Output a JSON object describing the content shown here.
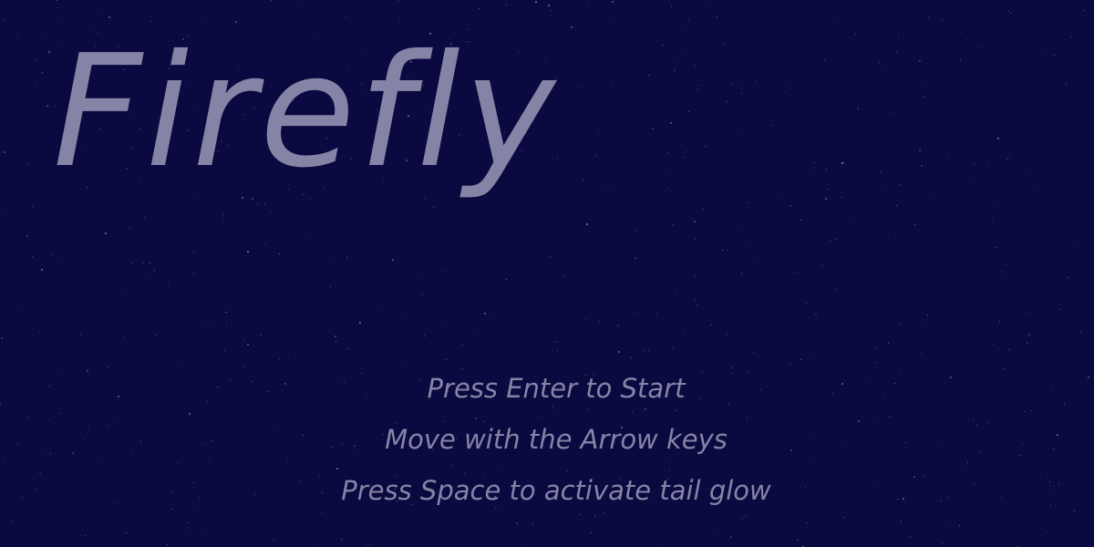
{
  "game": {
    "title": "Firefly",
    "instructions": [
      "Press Enter to Start",
      "Move with the Arrow keys",
      "Press Space to activate tail glow"
    ]
  },
  "colors": {
    "background": "#0a0940",
    "title_text": "#8584a6",
    "instruction_text": "#8584a6",
    "star": "#c8c8e8"
  }
}
